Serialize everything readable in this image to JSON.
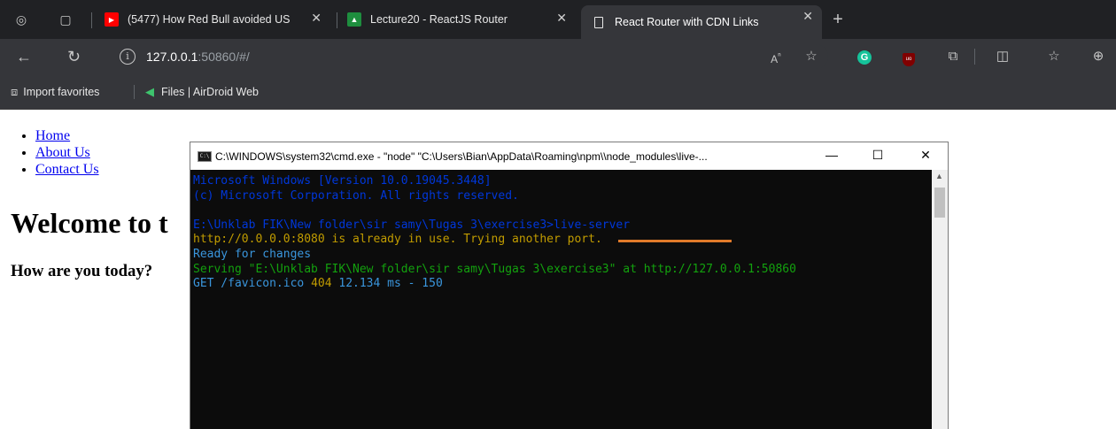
{
  "tabs": [
    {
      "title": "(5477) How Red Bull avoided US",
      "favicon": "youtube-icon",
      "color": "#ff0000"
    },
    {
      "title": "Lecture20 - ReactJS Router",
      "favicon": "classroom-icon",
      "color": "#1e8e3e"
    },
    {
      "title": "React Router with CDN Links",
      "favicon": "page-icon",
      "active": true
    }
  ],
  "address": {
    "host": "127.0.0.1",
    "rest": ":50860/#/"
  },
  "favorites": [
    {
      "label": "Import favorites",
      "icon": "import-icon"
    },
    {
      "label": "Files | AirDroid Web",
      "icon": "airdroid-icon"
    }
  ],
  "page": {
    "nav": [
      "Home",
      "About Us",
      "Contact Us"
    ],
    "heading": "Welcome to t",
    "subheading": "How are you today?"
  },
  "cmd": {
    "title": "C:\\WINDOWS\\system32\\cmd.exe - \"node\"  \"C:\\Users\\Bian\\AppData\\Roaming\\npm\\\\node_modules\\live-...",
    "lines": {
      "l1": "Microsoft Windows [Version 10.0.19045.3448]",
      "l2": "(c) Microsoft Corporation. All rights reserved.",
      "l3": "E:\\Unklab FIK\\New folder\\sir samy\\Tugas 3\\exercise3>live-server",
      "l4": "http://0.0.0.0:8080 is already in use. Trying another port.",
      "l5": "Ready for changes",
      "l6": "Serving \"E:\\Unklab FIK\\New folder\\sir samy\\Tugas 3\\exercise3\" at http://127.0.0.1:50860",
      "l7a": "GET /favicon.ico ",
      "l7b": "404",
      "l7c": " 12.134 ms - 150"
    }
  },
  "colors": {
    "annotation_underline": "#e07a2a"
  }
}
